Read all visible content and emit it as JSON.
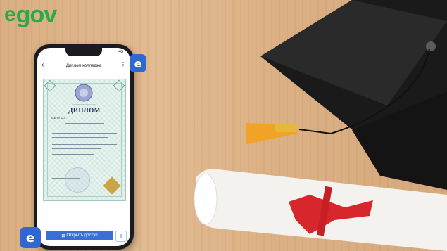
{
  "brand": {
    "logo_e": "e",
    "logo_gov": "gov",
    "color": "#2aa84a"
  },
  "phone": {
    "status_time": "",
    "status_network": "4G",
    "app_title": "Диплом колледжа",
    "diploma": {
      "caption": "Қазақстан Республикасы",
      "title": "ДИПЛОМ",
      "number": "ТКБ № 123"
    },
    "share_button_label": "Открыть доступ",
    "share_icon": "share-icon",
    "upload_icon": "upload-icon"
  },
  "badges": {
    "label": "e"
  },
  "colors": {
    "accent": "#3b6fd8",
    "badge": "#2f68d1",
    "ribbon": "#d8262d",
    "tassel": "#f0a326"
  }
}
